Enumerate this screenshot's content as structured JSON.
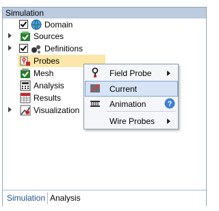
{
  "panel": {
    "title": "Simulation"
  },
  "tree": {
    "items": [
      {
        "label": "Domain",
        "icon": "globe-icon",
        "checked": true,
        "expander": "none"
      },
      {
        "label": "Sources",
        "icon": "sources-icon",
        "checked": false,
        "expander": "collapsed"
      },
      {
        "label": "Definitions",
        "icon": "definitions-icon",
        "checked": true,
        "expander": "collapsed"
      },
      {
        "label": "Probes",
        "icon": "probes-icon",
        "checked": false,
        "expander": "none",
        "selected": true
      },
      {
        "label": "Mesh",
        "icon": "mesh-icon",
        "checked": false,
        "expander": "none"
      },
      {
        "label": "Analysis",
        "icon": "analysis-icon",
        "checked": false,
        "expander": "none"
      },
      {
        "label": "Results",
        "icon": "results-icon",
        "checked": false,
        "expander": "none"
      },
      {
        "label": "Visualization",
        "icon": "visualization-icon",
        "checked": false,
        "expander": "collapsed"
      }
    ]
  },
  "context_menu": {
    "items": [
      {
        "label": "Field Probe",
        "icon": "field-probe-icon",
        "submenu": true
      },
      {
        "label": "Current",
        "icon": "current-probe-icon",
        "submenu": false,
        "highlighted": true
      },
      {
        "label": "Animation",
        "icon": "animation-icon",
        "submenu": false,
        "help": true
      },
      {
        "label": "Wire Probes",
        "icon": "",
        "submenu": true
      }
    ]
  },
  "tabs": [
    {
      "label": "Simulation",
      "active": true
    },
    {
      "label": "Analysis",
      "active": false
    }
  ],
  "colors": {
    "titlebar": "#bccbe0",
    "selection": "#fce7a8",
    "menu_highlight": "#d6e4f5",
    "tab_active": "#1f4f8c"
  }
}
